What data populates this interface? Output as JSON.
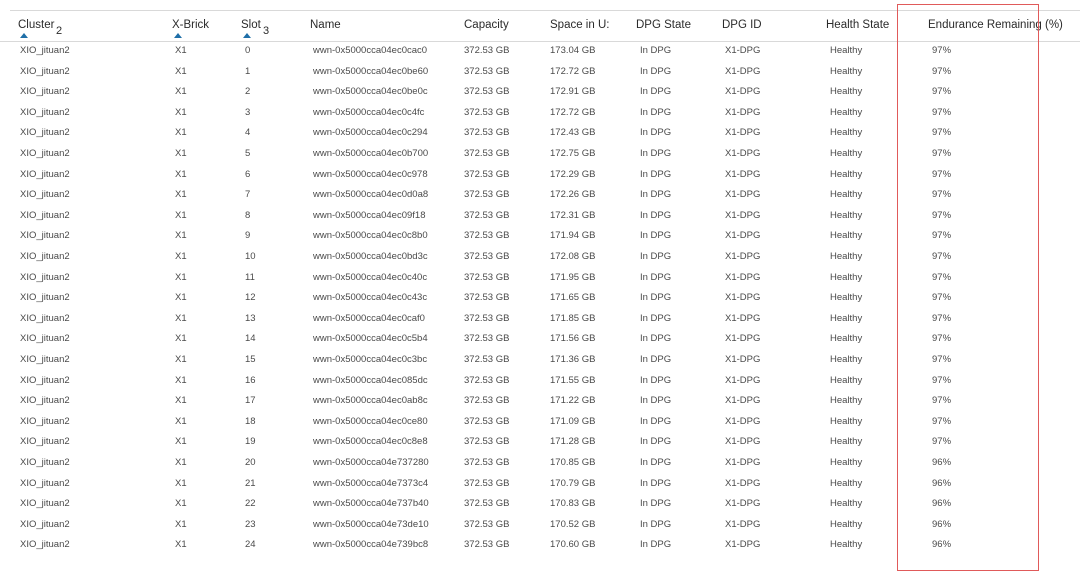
{
  "columns": [
    {
      "key": "cluster",
      "label": "Cluster",
      "sort_order": "2",
      "sorted": true
    },
    {
      "key": "xbrick",
      "label": "X-Brick",
      "sort_order": "",
      "sorted": true
    },
    {
      "key": "slot",
      "label": "Slot",
      "sort_order": "3",
      "sorted": true
    },
    {
      "key": "name",
      "label": "Name"
    },
    {
      "key": "capacity",
      "label": "Capacity"
    },
    {
      "key": "space",
      "label": "Space in U:"
    },
    {
      "key": "dpg_state",
      "label": "DPG State"
    },
    {
      "key": "dpg_id",
      "label": "DPG ID"
    },
    {
      "key": "health",
      "label": "Health State"
    },
    {
      "key": "endurance",
      "label": "Endurance Remaining (%)"
    }
  ],
  "rows": [
    [
      "XIO_jituan2",
      "X1",
      "0",
      "wwn-0x5000cca04ec0cac0",
      "372.53 GB",
      "173.04 GB",
      "In DPG",
      "X1-DPG",
      "Healthy",
      "97%"
    ],
    [
      "XIO_jituan2",
      "X1",
      "1",
      "wwn-0x5000cca04ec0be60",
      "372.53 GB",
      "172.72 GB",
      "In DPG",
      "X1-DPG",
      "Healthy",
      "97%"
    ],
    [
      "XIO_jituan2",
      "X1",
      "2",
      "wwn-0x5000cca04ec0be0c",
      "372.53 GB",
      "172.91 GB",
      "In DPG",
      "X1-DPG",
      "Healthy",
      "97%"
    ],
    [
      "XIO_jituan2",
      "X1",
      "3",
      "wwn-0x5000cca04ec0c4fc",
      "372.53 GB",
      "172.72 GB",
      "In DPG",
      "X1-DPG",
      "Healthy",
      "97%"
    ],
    [
      "XIO_jituan2",
      "X1",
      "4",
      "wwn-0x5000cca04ec0c294",
      "372.53 GB",
      "172.43 GB",
      "In DPG",
      "X1-DPG",
      "Healthy",
      "97%"
    ],
    [
      "XIO_jituan2",
      "X1",
      "5",
      "wwn-0x5000cca04ec0b700",
      "372.53 GB",
      "172.75 GB",
      "In DPG",
      "X1-DPG",
      "Healthy",
      "97%"
    ],
    [
      "XIO_jituan2",
      "X1",
      "6",
      "wwn-0x5000cca04ec0c978",
      "372.53 GB",
      "172.29 GB",
      "In DPG",
      "X1-DPG",
      "Healthy",
      "97%"
    ],
    [
      "XIO_jituan2",
      "X1",
      "7",
      "wwn-0x5000cca04ec0d0a8",
      "372.53 GB",
      "172.26 GB",
      "In DPG",
      "X1-DPG",
      "Healthy",
      "97%"
    ],
    [
      "XIO_jituan2",
      "X1",
      "8",
      "wwn-0x5000cca04ec09f18",
      "372.53 GB",
      "172.31 GB",
      "In DPG",
      "X1-DPG",
      "Healthy",
      "97%"
    ],
    [
      "XIO_jituan2",
      "X1",
      "9",
      "wwn-0x5000cca04ec0c8b0",
      "372.53 GB",
      "171.94 GB",
      "In DPG",
      "X1-DPG",
      "Healthy",
      "97%"
    ],
    [
      "XIO_jituan2",
      "X1",
      "10",
      "wwn-0x5000cca04ec0bd3c",
      "372.53 GB",
      "172.08 GB",
      "In DPG",
      "X1-DPG",
      "Healthy",
      "97%"
    ],
    [
      "XIO_jituan2",
      "X1",
      "11",
      "wwn-0x5000cca04ec0c40c",
      "372.53 GB",
      "171.95 GB",
      "In DPG",
      "X1-DPG",
      "Healthy",
      "97%"
    ],
    [
      "XIO_jituan2",
      "X1",
      "12",
      "wwn-0x5000cca04ec0c43c",
      "372.53 GB",
      "171.65 GB",
      "In DPG",
      "X1-DPG",
      "Healthy",
      "97%"
    ],
    [
      "XIO_jituan2",
      "X1",
      "13",
      "wwn-0x5000cca04ec0caf0",
      "372.53 GB",
      "171.85 GB",
      "In DPG",
      "X1-DPG",
      "Healthy",
      "97%"
    ],
    [
      "XIO_jituan2",
      "X1",
      "14",
      "wwn-0x5000cca04ec0c5b4",
      "372.53 GB",
      "171.56 GB",
      "In DPG",
      "X1-DPG",
      "Healthy",
      "97%"
    ],
    [
      "XIO_jituan2",
      "X1",
      "15",
      "wwn-0x5000cca04ec0c3bc",
      "372.53 GB",
      "171.36 GB",
      "In DPG",
      "X1-DPG",
      "Healthy",
      "97%"
    ],
    [
      "XIO_jituan2",
      "X1",
      "16",
      "wwn-0x5000cca04ec085dc",
      "372.53 GB",
      "171.55 GB",
      "In DPG",
      "X1-DPG",
      "Healthy",
      "97%"
    ],
    [
      "XIO_jituan2",
      "X1",
      "17",
      "wwn-0x5000cca04ec0ab8c",
      "372.53 GB",
      "171.22 GB",
      "In DPG",
      "X1-DPG",
      "Healthy",
      "97%"
    ],
    [
      "XIO_jituan2",
      "X1",
      "18",
      "wwn-0x5000cca04ec0ce80",
      "372.53 GB",
      "171.09 GB",
      "In DPG",
      "X1-DPG",
      "Healthy",
      "97%"
    ],
    [
      "XIO_jituan2",
      "X1",
      "19",
      "wwn-0x5000cca04ec0c8e8",
      "372.53 GB",
      "171.28 GB",
      "In DPG",
      "X1-DPG",
      "Healthy",
      "97%"
    ],
    [
      "XIO_jituan2",
      "X1",
      "20",
      "wwn-0x5000cca04e737280",
      "372.53 GB",
      "170.85 GB",
      "In DPG",
      "X1-DPG",
      "Healthy",
      "96%"
    ],
    [
      "XIO_jituan2",
      "X1",
      "21",
      "wwn-0x5000cca04e7373c4",
      "372.53 GB",
      "170.79 GB",
      "In DPG",
      "X1-DPG",
      "Healthy",
      "96%"
    ],
    [
      "XIO_jituan2",
      "X1",
      "22",
      "wwn-0x5000cca04e737b40",
      "372.53 GB",
      "170.83 GB",
      "In DPG",
      "X1-DPG",
      "Healthy",
      "96%"
    ],
    [
      "XIO_jituan2",
      "X1",
      "23",
      "wwn-0x5000cca04e73de10",
      "372.53 GB",
      "170.52 GB",
      "In DPG",
      "X1-DPG",
      "Healthy",
      "96%"
    ],
    [
      "XIO_jituan2",
      "X1",
      "24",
      "wwn-0x5000cca04e739bc8",
      "372.53 GB",
      "170.60 GB",
      "In DPG",
      "X1-DPG",
      "Healthy",
      "96%"
    ]
  ],
  "colors": {
    "sort_arrow": "#1f6fa8",
    "highlight_border": "#e05a5a",
    "divider": "#d9d9d9"
  },
  "icons": {
    "sort": "sort-ascending-icon"
  }
}
